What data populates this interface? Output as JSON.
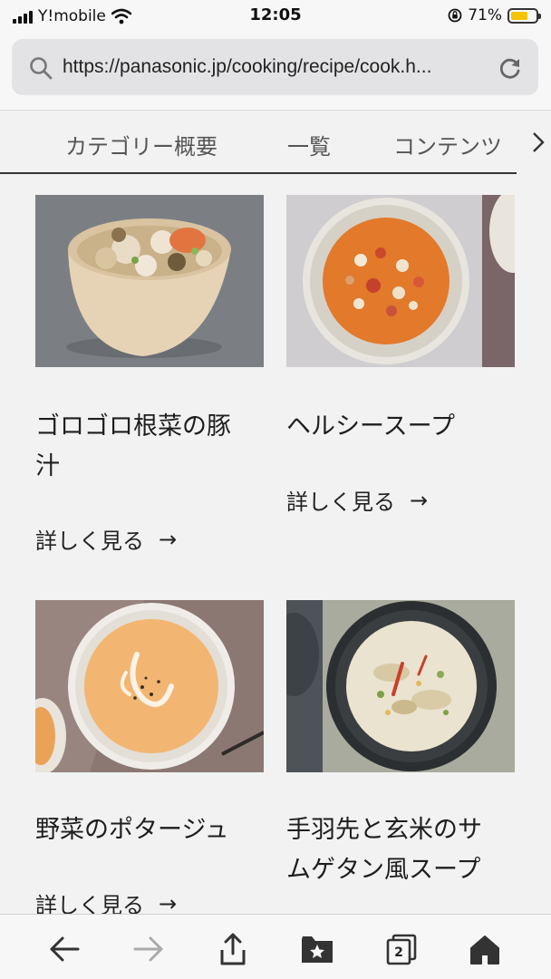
{
  "status_bar": {
    "carrier": "Y!mobile",
    "time": "12:05",
    "battery_percent": "71%",
    "battery_level": 0.71,
    "battery_color": "#f5c400"
  },
  "browser": {
    "url": "https://panasonic.jp/cooking/recipe/cook.h...",
    "search_icon": "search-icon",
    "reload_icon": "reload-icon"
  },
  "category_nav": {
    "items": [
      "カテゴリー概要",
      "一覧",
      "コンテンツ"
    ],
    "chevron_icon": "chevron-right-icon"
  },
  "recipes": [
    {
      "title_line1": "ゴロゴロ根菜の豚",
      "title_line2": "汁",
      "link": "詳しく見る",
      "arrow": "→"
    },
    {
      "title_line1": "ヘルシースープ",
      "title_line2": "",
      "link": "詳しく見る",
      "arrow": "→"
    },
    {
      "title_line1": "野菜のポタージュ",
      "title_line2": "",
      "link": "詳しく見る",
      "arrow": "→"
    },
    {
      "title_line1": "手羽先と玄米のサ",
      "title_line2": "ムゲタン風スープ",
      "link": "",
      "arrow": ""
    }
  ],
  "toolbar": {
    "back_icon": "back-arrow-icon",
    "forward_icon": "forward-arrow-icon",
    "share_icon": "share-icon",
    "bookmarks_icon": "bookmarks-icon",
    "tabs_icon": "tabs-icon",
    "tabs_count": "2",
    "home_icon": "home-icon"
  }
}
